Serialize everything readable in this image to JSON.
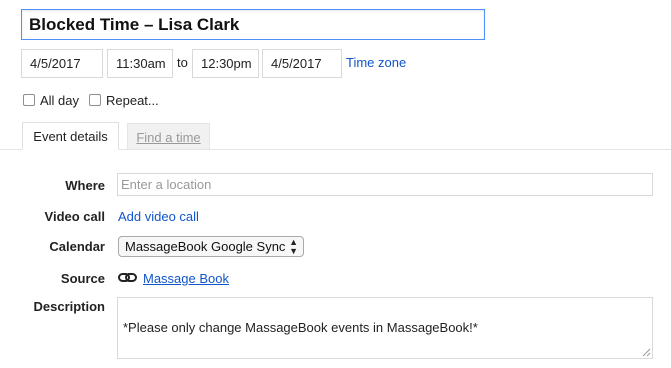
{
  "event": {
    "title": "Blocked Time – Lisa Clark"
  },
  "datetime": {
    "start_date": "4/5/2017",
    "start_time": "11:30am",
    "separator": "to",
    "end_time": "12:30pm",
    "end_date": "4/5/2017",
    "timezone_link": "Time zone"
  },
  "options": {
    "all_day": "All day",
    "repeat": "Repeat..."
  },
  "tabs": {
    "event_details": "Event details",
    "find_time": "Find a time"
  },
  "details": {
    "where_label": "Where",
    "where_placeholder": "Enter a location",
    "video_label": "Video call",
    "video_link": "Add video call",
    "calendar_label": "Calendar",
    "calendar_value": "MassageBook Google Sync",
    "source_label": "Source",
    "source_link": "Massage Book",
    "description_label": "Description",
    "description_text": "*Please only change MassageBook events in MassageBook!*"
  },
  "colors": {
    "link": "#1155cc",
    "focus_border": "#4d90fe",
    "tab_inactive_bg": "#f1f1f1"
  },
  "icons": {
    "source": "link-chain-icon",
    "select": "updown-arrows-icon"
  }
}
